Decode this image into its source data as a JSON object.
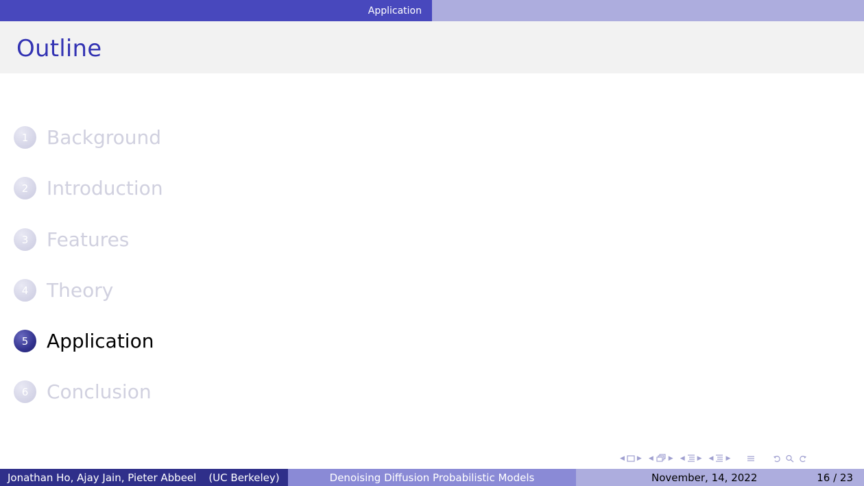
{
  "header": {
    "section": "Application"
  },
  "frame": {
    "title": "Outline"
  },
  "toc": [
    {
      "number": "1",
      "label": "Background",
      "current": false
    },
    {
      "number": "2",
      "label": "Introduction",
      "current": false
    },
    {
      "number": "3",
      "label": "Features",
      "current": false
    },
    {
      "number": "4",
      "label": "Theory",
      "current": false
    },
    {
      "number": "5",
      "label": "Application",
      "current": true
    },
    {
      "number": "6",
      "label": "Conclusion",
      "current": false
    }
  ],
  "footer": {
    "authors": "Jonathan Ho, Ajay Jain, Pieter Abbeel",
    "institute": "(UC Berkeley)",
    "title": "Denoising Diffusion Probabilistic Models",
    "date": "November, 14, 2022",
    "page": "16 / 23"
  },
  "nav_icons": [
    "frame-back-icon",
    "frame-icon",
    "frame-forward-icon",
    "slide-back-icon",
    "slide-icon",
    "slide-forward-icon",
    "subsection-back-icon",
    "subsection-icon",
    "subsection-forward-icon",
    "section-back-icon",
    "section-icon",
    "section-forward-icon",
    "appendix-icon",
    "search-icon",
    "undo-icon"
  ],
  "colors": {
    "structure": "#4848bd",
    "title_text": "#3333b3",
    "footer_dark": "#2f2f8a",
    "footer_mid": "#8a8ad6",
    "footer_light": "#adadde"
  }
}
